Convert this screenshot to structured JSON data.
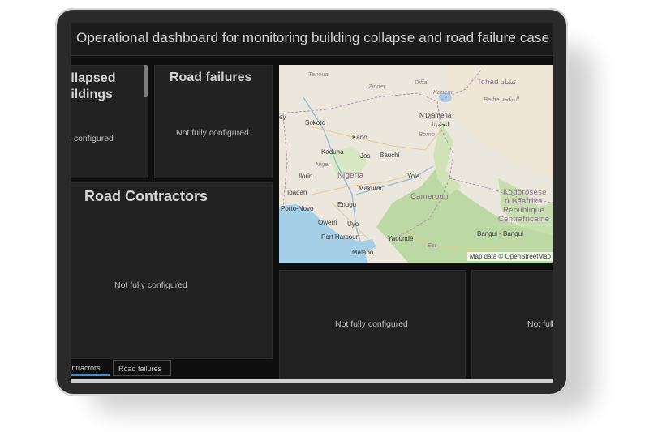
{
  "header": {
    "title": "Operational dashboard for monitoring building collapse and road failure case"
  },
  "panels": {
    "collapsed": {
      "title_line1": "Collapsed",
      "title_line2": "Buildings",
      "message": "Not fully configured"
    },
    "road_failures": {
      "title": "Road failures",
      "message": "Not fully configured"
    },
    "road_contractors": {
      "title": "Road Contractors",
      "message": "Not fully configured"
    },
    "bottom_middle": {
      "message": "Not fully configured"
    },
    "bottom_right": {
      "message": "Not fully configured"
    }
  },
  "map": {
    "attribution": "Map data © OpenStreetMap",
    "labels": {
      "tahoua": "Tahoua",
      "zinder": "Zinder",
      "diffa": "Diffa",
      "kanem": "Kanem",
      "tchad": "Tchad تشاد",
      "batha": "Batha البطحة",
      "sokoto": "Sokoto",
      "kano": "Kano",
      "ndjamena": "N'Djaména",
      "ndjamena_ar": "انجمينا",
      "borno": "Borno",
      "kaduna": "Kaduna",
      "jos": "Jos",
      "bauchi": "Bauchi",
      "niger": "Niger",
      "ilorin": "Ilorin",
      "nigeria": "Nigeria",
      "yola": "Yola",
      "ibadan": "Ibadan",
      "makurdi": "Makurdi",
      "cameroun": "Cameroun",
      "porto_novo": "Porto-Novo",
      "enugu": "Enugu",
      "owerri": "Owerri",
      "uyo": "Uyo",
      "port_harcourt": "Port Harcourt",
      "yaounde": "Yaoundé",
      "malabo": "Malabo",
      "est": "Est",
      "bangui": "Bangui - Bangui",
      "car1": "Ködörösêse",
      "car2": "tî Bêafrîka",
      "car3": "République",
      "car4": "Centrafricaine",
      "ey": "ey"
    }
  },
  "tabs": [
    {
      "label": "Road Contractors"
    },
    {
      "label": "Road failures"
    }
  ]
}
